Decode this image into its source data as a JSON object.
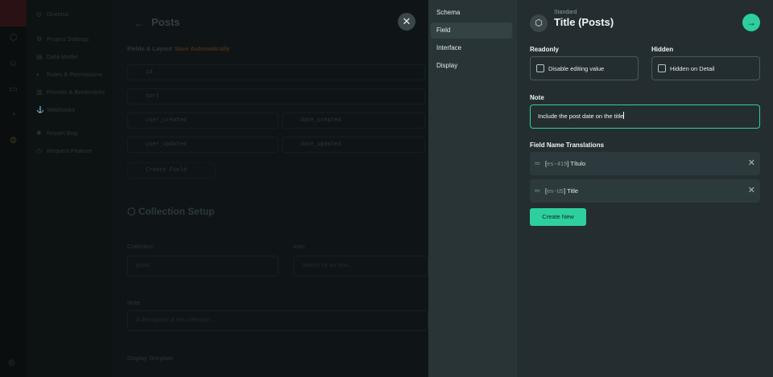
{
  "background": {
    "nav_items": [
      "Directus",
      "Project Settings",
      "Data Model",
      "Roles & Permissions",
      "Presets & Bookmarks",
      "Webhooks",
      "Report Bug",
      "Request Feature"
    ],
    "page_title": "Posts",
    "section_label": "Fields & Layout",
    "section_warning": "Save Automatically",
    "fields": [
      "id",
      "sort",
      "user_created",
      "date_created",
      "user_updated",
      "date_updated"
    ],
    "create_field": "Create Field",
    "collection_setup": "Collection Setup",
    "collection_label": "Collection",
    "collection_value": "posts",
    "icon_label": "Icon",
    "icon_placeholder": "Search for an icon...",
    "note_label": "Note",
    "note_placeholder": "A description of this collection...",
    "display_template_label": "Display Template"
  },
  "drawer": {
    "tabs": [
      "Schema",
      "Field",
      "Interface",
      "Display"
    ],
    "active_tab": "Field",
    "header_subtitle": "Standard",
    "header_title": "Title (Posts)",
    "readonly_label": "Readonly",
    "readonly_checkbox": "Disable editing value",
    "hidden_label": "Hidden",
    "hidden_checkbox": "Hidden on Detail",
    "note_label": "Note",
    "note_value": "Include the post date on the title",
    "translations_label": "Field Name Translations",
    "translations": [
      {
        "code": "es-419",
        "value": "Título"
      },
      {
        "code": "en-US",
        "value": "Title"
      }
    ],
    "create_new": "Create New",
    "accent_color": "#2ecf9e"
  },
  "icons": [
    "close-icon",
    "box-icon",
    "arrow-right-icon",
    "drag-handle-icon",
    "remove-icon",
    "checkbox-icon"
  ]
}
